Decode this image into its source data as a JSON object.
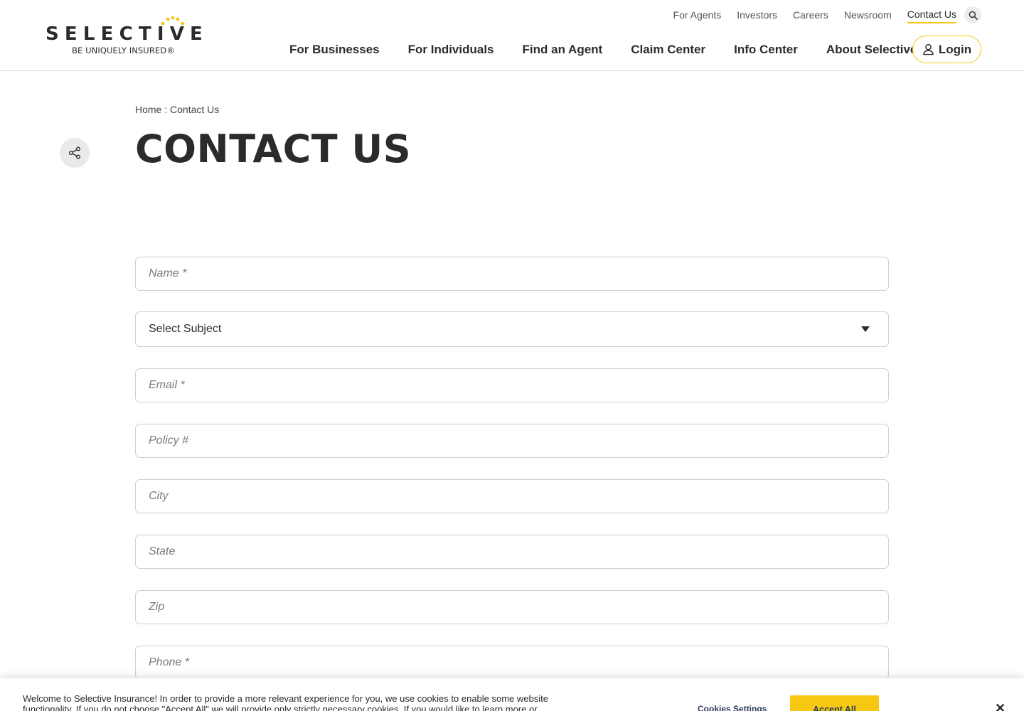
{
  "brand": {
    "name": "SELECTIVE",
    "tagline": "BE UNIQUELY INSURED®",
    "accent_color": "#f6c812"
  },
  "utility_nav": {
    "items": [
      "For Agents",
      "Investors",
      "Careers",
      "Newsroom",
      "Contact Us"
    ],
    "active": "Contact Us",
    "search_icon": "search-icon"
  },
  "main_nav": {
    "items": [
      "For Businesses",
      "For Individuals",
      "Find an Agent",
      "Claim Center",
      "Info Center",
      "About Selective"
    ],
    "login_label": "Login",
    "login_icon": "user-icon"
  },
  "breadcrumb": "Home : Contact Us",
  "share_icon": "share-icon",
  "page_title": "CONTACT US",
  "form": {
    "name_placeholder": "Name *",
    "subject_selected": "Select Subject",
    "email_placeholder": "Email *",
    "policy_placeholder": "Policy #",
    "city_placeholder": "City",
    "state_placeholder": "State",
    "zip_placeholder": "Zip",
    "phone_placeholder": "Phone *"
  },
  "cookie_banner": {
    "text": "Welcome to Selective Insurance! In order to provide a more relevant experience for you, we use cookies to enable some website functionality. If you do not choose \"Accept All\" we will provide only strictly necessary cookies. If you would like to learn more or",
    "settings_label": "Cookies Settings",
    "accept_label": "Accept All",
    "close_symbol": "✕"
  }
}
